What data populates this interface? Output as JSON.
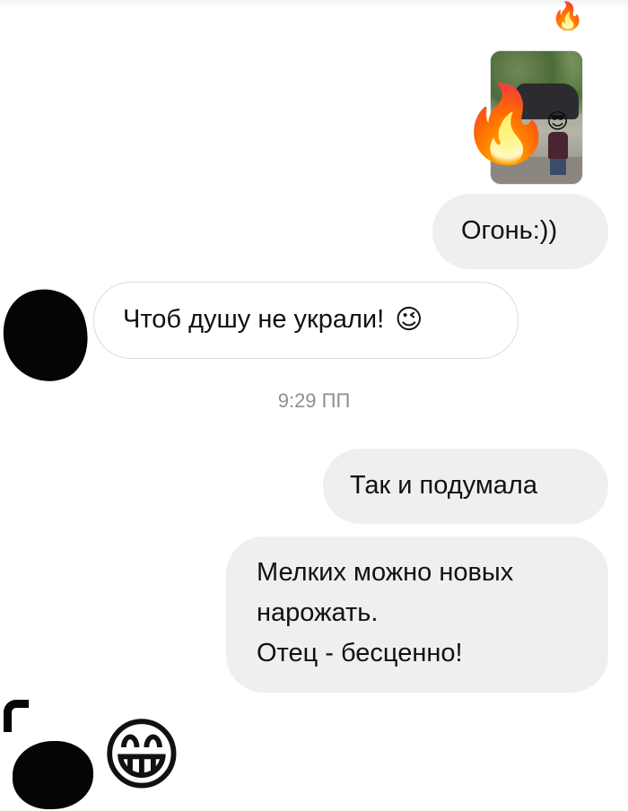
{
  "chat": {
    "reaction_emoji": "🔥",
    "photo": {
      "overlay_emoji": "🔥",
      "face_cover_emoji": "😎"
    },
    "messages": [
      {
        "direction": "sent",
        "text": "Огонь:))"
      },
      {
        "direction": "received",
        "text": "Чтоб душу не украли!",
        "emoji": "😉"
      },
      {
        "direction": "sent",
        "text": "Так и подумала"
      },
      {
        "direction": "sent",
        "lines": [
          "Мелких можно новых",
          "нарожать.",
          "Отец - бесценно!"
        ]
      },
      {
        "direction": "received",
        "emoji": "😁"
      }
    ],
    "timestamp": "9:29 ПП"
  }
}
